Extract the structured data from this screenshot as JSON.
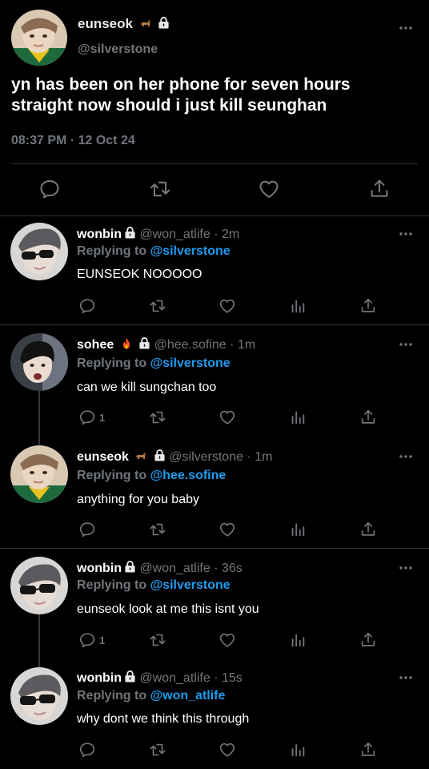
{
  "main_tweet": {
    "name": "eunseok",
    "handle": "@silverstone",
    "text": "yn has been on her phone for seven hours straight now should i just kill seunghan",
    "timestamp": "08:37 PM · 12 Oct 24"
  },
  "replies": [
    {
      "name": "wonbin",
      "handle": "@won_atlife",
      "time": "2m",
      "replying_prefix": "Replying to ",
      "replying_to": "@silverstone",
      "text": "EUNSEOK NOOOOO",
      "reply_count": ""
    },
    {
      "name": "sohee",
      "handle": "@hee.sofine",
      "time": "1m",
      "replying_prefix": "Replying to ",
      "replying_to": "@silverstone",
      "text": "can we kill sungchan too",
      "reply_count": "1"
    },
    {
      "name": "eunseok",
      "handle": "@silverstone",
      "time": "1m",
      "replying_prefix": "Replying to ",
      "replying_to": "@hee.sofine",
      "text": "anything for you baby",
      "reply_count": ""
    },
    {
      "name": "wonbin",
      "handle": "@won_atlife",
      "time": "36s",
      "replying_prefix": "Replying to ",
      "replying_to": "@silverstone",
      "text": "eunseok look at me this isnt you",
      "reply_count": "1"
    },
    {
      "name": "wonbin",
      "handle": "@won_atlife",
      "time": "15s",
      "replying_prefix": "Replying to ",
      "replying_to": "@won_atlife",
      "text": "why dont we think this through",
      "reply_count": ""
    }
  ],
  "separator": "·",
  "colors": {
    "background": "#000000",
    "text": "#e7e9ea",
    "muted": "#71767b",
    "link": "#1d9bf0",
    "divider": "#2f3336"
  },
  "icons": [
    "lock-icon",
    "dog-emoji",
    "fire-emoji",
    "more-icon",
    "reply-icon",
    "retweet-icon",
    "like-icon",
    "views-icon",
    "share-icon"
  ]
}
